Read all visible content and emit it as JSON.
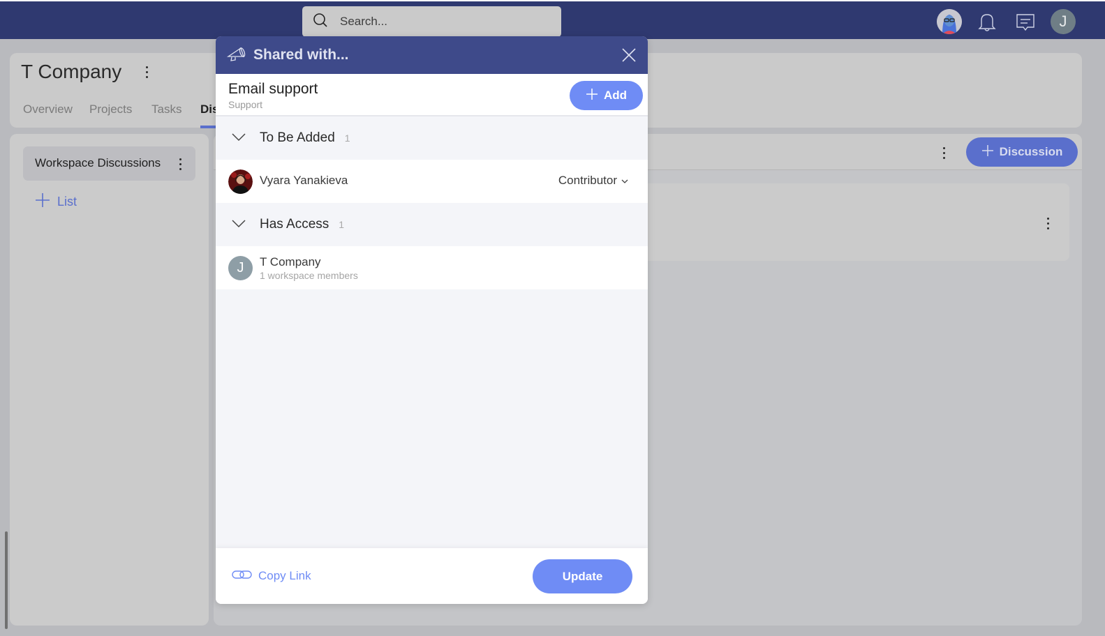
{
  "topbar": {
    "search_placeholder": "Search...",
    "icons": [
      "search-icon",
      "user-avatar-illustration",
      "bell-icon",
      "chat-icon"
    ],
    "user_initial": "J"
  },
  "page": {
    "company_title": "T Company",
    "tabs": [
      {
        "label": "Overview",
        "active": false
      },
      {
        "label": "Projects",
        "active": false
      },
      {
        "label": "Tasks",
        "active": false
      },
      {
        "label": "Dis",
        "active": true
      }
    ],
    "sidebar": {
      "workspace_item": "Workspace Discussions",
      "add_list_label": "List"
    },
    "main": {
      "new_discussion_label": "Discussion"
    },
    "accent_color": "#5a6fcc"
  },
  "modal": {
    "title": "Shared with...",
    "entity": {
      "name": "Email support",
      "type": "Support"
    },
    "add_label": "Add",
    "sections": [
      {
        "title": "To Be Added",
        "count": "1",
        "items": [
          {
            "name": "Vyara Yanakieva",
            "role": "Contributor"
          }
        ]
      },
      {
        "title": "Has Access",
        "count": "1",
        "items": [
          {
            "initial": "J",
            "name": "T Company",
            "subtitle": "1 workspace members"
          }
        ]
      }
    ],
    "copy_link_label": "Copy Link",
    "update_label": "Update",
    "header_color": "#3e4a8a",
    "button_color": "#6f8cf5"
  }
}
